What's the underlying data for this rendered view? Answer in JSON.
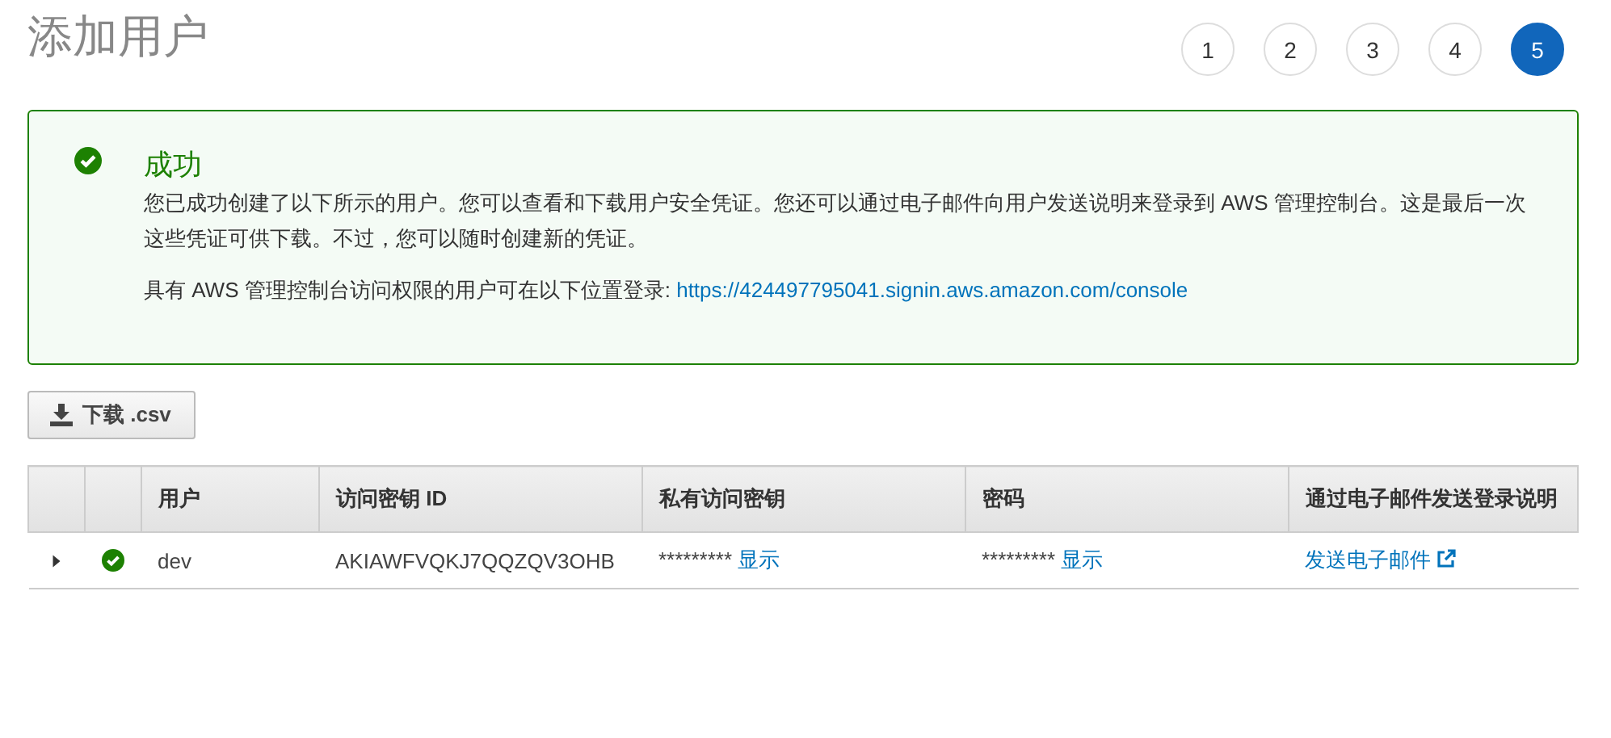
{
  "page_title": "添加用户",
  "steps": [
    {
      "label": "1",
      "selected": false
    },
    {
      "label": "2",
      "selected": false
    },
    {
      "label": "3",
      "selected": false
    },
    {
      "label": "4",
      "selected": false
    },
    {
      "label": "5",
      "selected": true
    }
  ],
  "alert": {
    "kind": "success",
    "title": "成功",
    "message": "您已成功创建了以下所示的用户。您可以查看和下载用户安全凭证。您还可以通过电子邮件向用户发送说明来登录到 AWS 管理控制台。这是最后一次这些凭证可供下载。不过，您可以随时创建新的凭证。",
    "signin_label": "具有 AWS 管理控制台访问权限的用户可在以下位置登录:",
    "signin_link": "https://424497795041.signin.aws.amazon.com/console"
  },
  "download_button": "下载 .csv",
  "table": {
    "columns": [
      "用户",
      "访问密钥 ID",
      "私有访问密钥",
      "密码",
      "通过电子邮件发送登录说明"
    ],
    "rows": [
      {
        "expanded": false,
        "succeeded": true,
        "user": "dev",
        "access_key_id": "AKIAWFVQKJ7QQZQV3OHB",
        "secret_mask": "*********",
        "secret_link": "显示",
        "password_mask": "*********",
        "password_link": "显示",
        "email_link": "发送电子邮件"
      }
    ]
  }
}
